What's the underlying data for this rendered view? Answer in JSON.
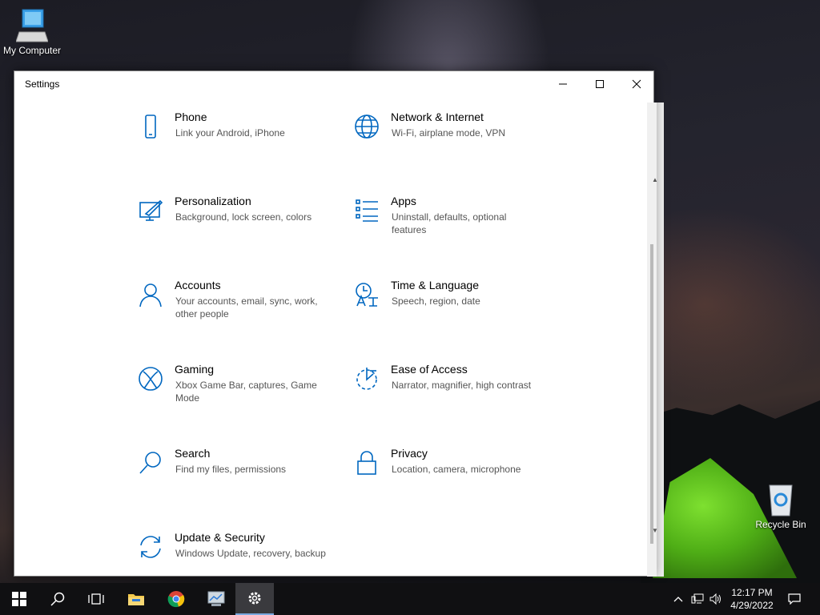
{
  "desktop": {
    "icons": [
      {
        "label": "My Computer",
        "icon": "computer-icon"
      },
      {
        "label": "Recycle Bin",
        "icon": "recycle-bin-icon"
      }
    ]
  },
  "window": {
    "title": "Settings",
    "controls": {
      "minimize": "minimize-icon",
      "maximize": "maximize-icon",
      "close": "close-icon"
    }
  },
  "settings": {
    "tiles": [
      {
        "name": "Phone",
        "desc": "Link your Android, iPhone",
        "icon": "phone-icon"
      },
      {
        "name": "Network & Internet",
        "desc": "Wi-Fi, airplane mode, VPN",
        "icon": "globe-icon"
      },
      {
        "name": "Personalization",
        "desc": "Background, lock screen, colors",
        "icon": "paintbrush-icon"
      },
      {
        "name": "Apps",
        "desc": "Uninstall, defaults, optional features",
        "icon": "apps-list-icon"
      },
      {
        "name": "Accounts",
        "desc": "Your accounts, email, sync, work, other people",
        "icon": "person-icon"
      },
      {
        "name": "Time & Language",
        "desc": "Speech, region, date",
        "icon": "time-language-icon"
      },
      {
        "name": "Gaming",
        "desc": "Xbox Game Bar, captures, Game Mode",
        "icon": "xbox-icon"
      },
      {
        "name": "Ease of Access",
        "desc": "Narrator, magnifier, high contrast",
        "icon": "ease-of-access-icon"
      },
      {
        "name": "Search",
        "desc": "Find my files, permissions",
        "icon": "search-icon"
      },
      {
        "name": "Privacy",
        "desc": "Location, camera, microphone",
        "icon": "lock-icon"
      },
      {
        "name": "Update & Security",
        "desc": "Windows Update, recovery, backup",
        "icon": "sync-icon"
      }
    ]
  },
  "taskbar": {
    "buttons": [
      "start-icon",
      "search-icon",
      "task-view-icon",
      "file-explorer-icon",
      "chrome-icon",
      "control-panel-icon",
      "settings-gear-icon"
    ],
    "active": "settings-gear-icon",
    "tray": [
      "chevron-up-icon",
      "network-icon",
      "volume-icon"
    ],
    "time": "12:17 PM",
    "date": "4/29/2022",
    "notifications": "notification-icon"
  },
  "colors": {
    "accent": "#0067c0",
    "taskbar": "#101012"
  }
}
